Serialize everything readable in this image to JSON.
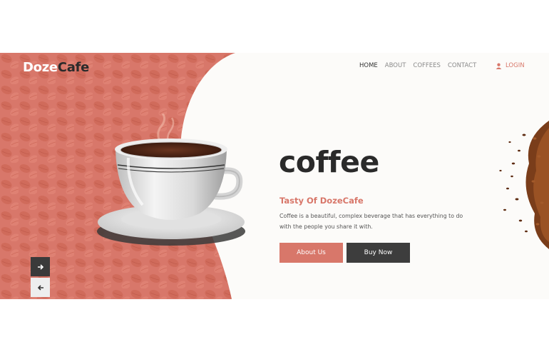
{
  "brand": {
    "logo_part1": "Doze",
    "logo_part2": "Cafe"
  },
  "nav": {
    "items": [
      {
        "label": "HOME",
        "active": true
      },
      {
        "label": "ABOUT",
        "active": false
      },
      {
        "label": "COFFEES",
        "active": false
      },
      {
        "label": "CONTACT",
        "active": false
      }
    ],
    "login_label": "LOGIN",
    "login_icon": "user-icon"
  },
  "hero": {
    "title": "coffee",
    "subtitle": "Tasty Of DozeCafe",
    "description": "Coffee is a beautiful, complex beverage that has everything to do with the people you share it with.",
    "about_button": "About Us",
    "buy_button": "Buy Now"
  },
  "slider": {
    "next_icon": "arrow-right-icon",
    "prev_icon": "arrow-left-icon"
  },
  "colors": {
    "accent": "#d8776a",
    "dark": "#3d3d3d",
    "background": "#fcfbf9"
  }
}
